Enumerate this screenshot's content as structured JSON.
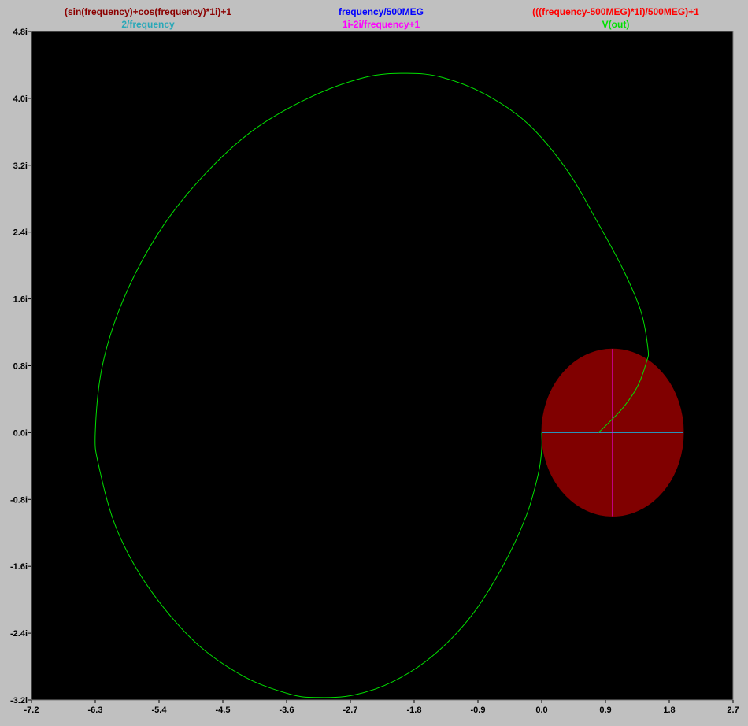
{
  "chart_data": {
    "type": "line",
    "title": "",
    "xlabel": "",
    "ylabel": "",
    "xlim": [
      -7.2,
      2.7
    ],
    "ylim": [
      -3.2,
      4.8
    ],
    "grid": false,
    "plot_background": "#000000",
    "frame_background": "#c0c0c0",
    "x_ticks": [
      {
        "value": -7.2,
        "label": "-7.2"
      },
      {
        "value": -6.3,
        "label": "-6.3"
      },
      {
        "value": -5.4,
        "label": "-5.4"
      },
      {
        "value": -4.5,
        "label": "-4.5"
      },
      {
        "value": -3.6,
        "label": "-3.6"
      },
      {
        "value": -2.7,
        "label": "-2.7"
      },
      {
        "value": -1.8,
        "label": "-1.8"
      },
      {
        "value": -0.9,
        "label": "-0.9"
      },
      {
        "value": 0.0,
        "label": "0.0"
      },
      {
        "value": 0.9,
        "label": "0.9"
      },
      {
        "value": 1.8,
        "label": "1.8"
      },
      {
        "value": 2.7,
        "label": "2.7"
      }
    ],
    "y_ticks": [
      {
        "value": 4.8,
        "label": "4.8i"
      },
      {
        "value": 4.0,
        "label": "4.0i"
      },
      {
        "value": 3.2,
        "label": "3.2i"
      },
      {
        "value": 2.4,
        "label": "2.4i"
      },
      {
        "value": 1.6,
        "label": "1.6i"
      },
      {
        "value": 0.8,
        "label": "0.8i"
      },
      {
        "value": 0.0,
        "label": "0.0i"
      },
      {
        "value": -0.8,
        "label": "-0.8i"
      },
      {
        "value": -1.6,
        "label": "-1.6i"
      },
      {
        "value": -2.4,
        "label": "-2.4i"
      },
      {
        "value": -3.2,
        "label": "-3.2i"
      }
    ],
    "legend_rows": [
      [
        {
          "label": "(sin(frequency)+cos(frequency)*1i)+1",
          "color": "#8b0000"
        },
        {
          "label": "frequency/500MEG",
          "color": "#0000ff"
        },
        {
          "label": "(((frequency-500MEG)*1i)/500MEG)+1",
          "color": "#ff0000"
        }
      ],
      [
        {
          "label": "2/frequency",
          "color": "#2aa8b8"
        },
        {
          "label": "1i-2i/frequency+1",
          "color": "#ff00ff"
        },
        {
          "label": "V(out)",
          "color": "#00e000"
        }
      ]
    ],
    "series": [
      {
        "name": "(sin(frequency)+cos(frequency)*1i)+1",
        "color": "#800000",
        "kind": "filled-circle",
        "center": [
          1.0,
          0.0
        ],
        "radius": 1.0
      },
      {
        "name": "frequency/500MEG",
        "color": "#0000ff",
        "kind": "line",
        "x": [
          0.0,
          2.0
        ],
        "y": [
          0.0,
          0.0
        ]
      },
      {
        "name": "2/frequency",
        "color": "#2aa8b8",
        "kind": "line",
        "x": [
          0.0,
          2.0
        ],
        "y": [
          0.0,
          0.0
        ]
      },
      {
        "name": "(((frequency-500MEG)*1i)/500MEG)+1",
        "color": "#ff0000",
        "kind": "line",
        "x": [
          1.0,
          1.0
        ],
        "y": [
          -1.0,
          1.0
        ]
      },
      {
        "name": "1i-2i/frequency+1",
        "color": "#ff00ff",
        "kind": "line",
        "x": [
          1.0,
          1.0
        ],
        "y": [
          -1.0,
          1.0
        ]
      },
      {
        "name": "V(out)",
        "color": "#00e000",
        "kind": "line",
        "x": [
          0.0,
          0.0,
          -0.05,
          -0.22,
          -0.55,
          -1.0,
          -1.55,
          -2.1,
          -2.65,
          -3.15,
          -3.55,
          -4.2,
          -4.9,
          -5.55,
          -6.0,
          -6.25,
          -6.3,
          -6.2,
          -5.9,
          -5.4,
          -4.8,
          -4.1,
          -3.3,
          -2.5,
          -1.9,
          -1.4,
          -0.8,
          -0.2,
          0.35,
          0.8,
          1.15,
          1.4,
          1.5,
          1.48,
          1.35,
          1.15,
          0.9,
          0.8
        ],
        "y": [
          0.0,
          -0.2,
          -0.5,
          -1.0,
          -1.6,
          -2.2,
          -2.68,
          -2.98,
          -3.14,
          -3.17,
          -3.13,
          -2.92,
          -2.5,
          -1.85,
          -1.15,
          -0.4,
          0.0,
          0.8,
          1.6,
          2.4,
          3.05,
          3.6,
          4.0,
          4.25,
          4.3,
          4.25,
          4.05,
          3.7,
          3.15,
          2.5,
          1.95,
          1.45,
          1.0,
          0.85,
          0.55,
          0.3,
          0.08,
          0.0
        ]
      }
    ]
  }
}
